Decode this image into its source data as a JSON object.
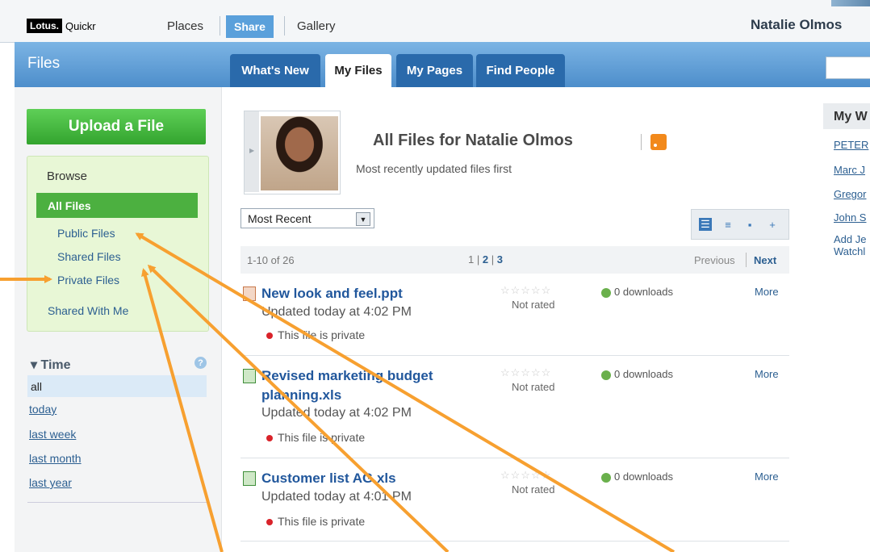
{
  "topbar": {
    "logo_lotus": "Lotus.",
    "logo_quickr": "Quickr",
    "places": "Places",
    "share": "Share",
    "gallery": "Gallery",
    "user_name": "Natalie Olmos"
  },
  "header": {
    "title": "Files",
    "tabs": [
      {
        "label": "What's New"
      },
      {
        "label": "My Files"
      },
      {
        "label": "My Pages"
      },
      {
        "label": "Find People"
      }
    ]
  },
  "sidebar": {
    "upload_label": "Upload a File",
    "browse_title": "Browse",
    "all_files": "All Files",
    "public_files": "Public Files",
    "shared_files": "Shared Files",
    "private_files": "Private Files",
    "shared_with_me": "Shared With Me",
    "time_title": "▾ Time",
    "help": "?",
    "time_items": [
      "all",
      "today",
      "last week",
      "last month",
      "last year"
    ]
  },
  "main": {
    "title": "All Files for Natalie Olmos",
    "subtitle": "Most recently updated files first",
    "sort_value": "Most Recent",
    "pager": {
      "count": "1-10 of 26",
      "page1": "1",
      "page2": "2",
      "page3": "3",
      "previous": "Previous",
      "next": "Next"
    },
    "files": [
      {
        "name": "New look and feel.ppt",
        "updated": "Updated today at 4:02 PM",
        "privacy": "This file is private",
        "rating": "Not rated",
        "downloads": "0 downloads",
        "more": "More",
        "kind": "ppt"
      },
      {
        "name_line1": "Revised marketing budget",
        "name_line2": "planning.xls",
        "updated": "Updated today at 4:02 PM",
        "privacy": "This file is private",
        "rating": "Not rated",
        "downloads": "0 downloads",
        "more": "More",
        "kind": "xls"
      },
      {
        "name": "Customer list AG.xls",
        "updated": "Updated today at 4:01 PM",
        "privacy": "This file is private",
        "rating": "Not rated",
        "downloads": "0 downloads",
        "more": "More",
        "kind": "xls"
      }
    ],
    "stars": "☆☆☆☆☆"
  },
  "right": {
    "head": "My W",
    "links": [
      "PETER",
      "Marc J",
      "Gregor",
      "John S"
    ],
    "add_watchlist_line1": "Add Je",
    "add_watchlist_line2": "Watchl"
  },
  "colors": {
    "header_blue": "#4d8ecb",
    "share_blue": "#5aa0db",
    "upload_green": "#33a42e",
    "annotation_orange": "#f7a030",
    "link_blue": "#21579c"
  }
}
